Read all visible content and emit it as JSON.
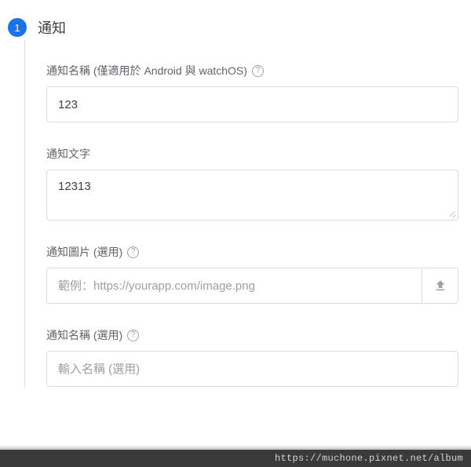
{
  "step": {
    "number": "1",
    "title": "通知"
  },
  "fields": {
    "name": {
      "label": "通知名稱 (僅適用於 Android 與 watchOS)",
      "value": "123"
    },
    "text": {
      "label": "通知文字",
      "value": "12313"
    },
    "image": {
      "label": "通知圖片 (選用)",
      "placeholder": "範例：https://yourapp.com/image.png",
      "value": ""
    },
    "optName": {
      "label": "通知名稱 (選用)",
      "placeholder": "輸入名稱 (選用)",
      "value": ""
    }
  },
  "footer": "https://muchone.pixnet.net/album"
}
